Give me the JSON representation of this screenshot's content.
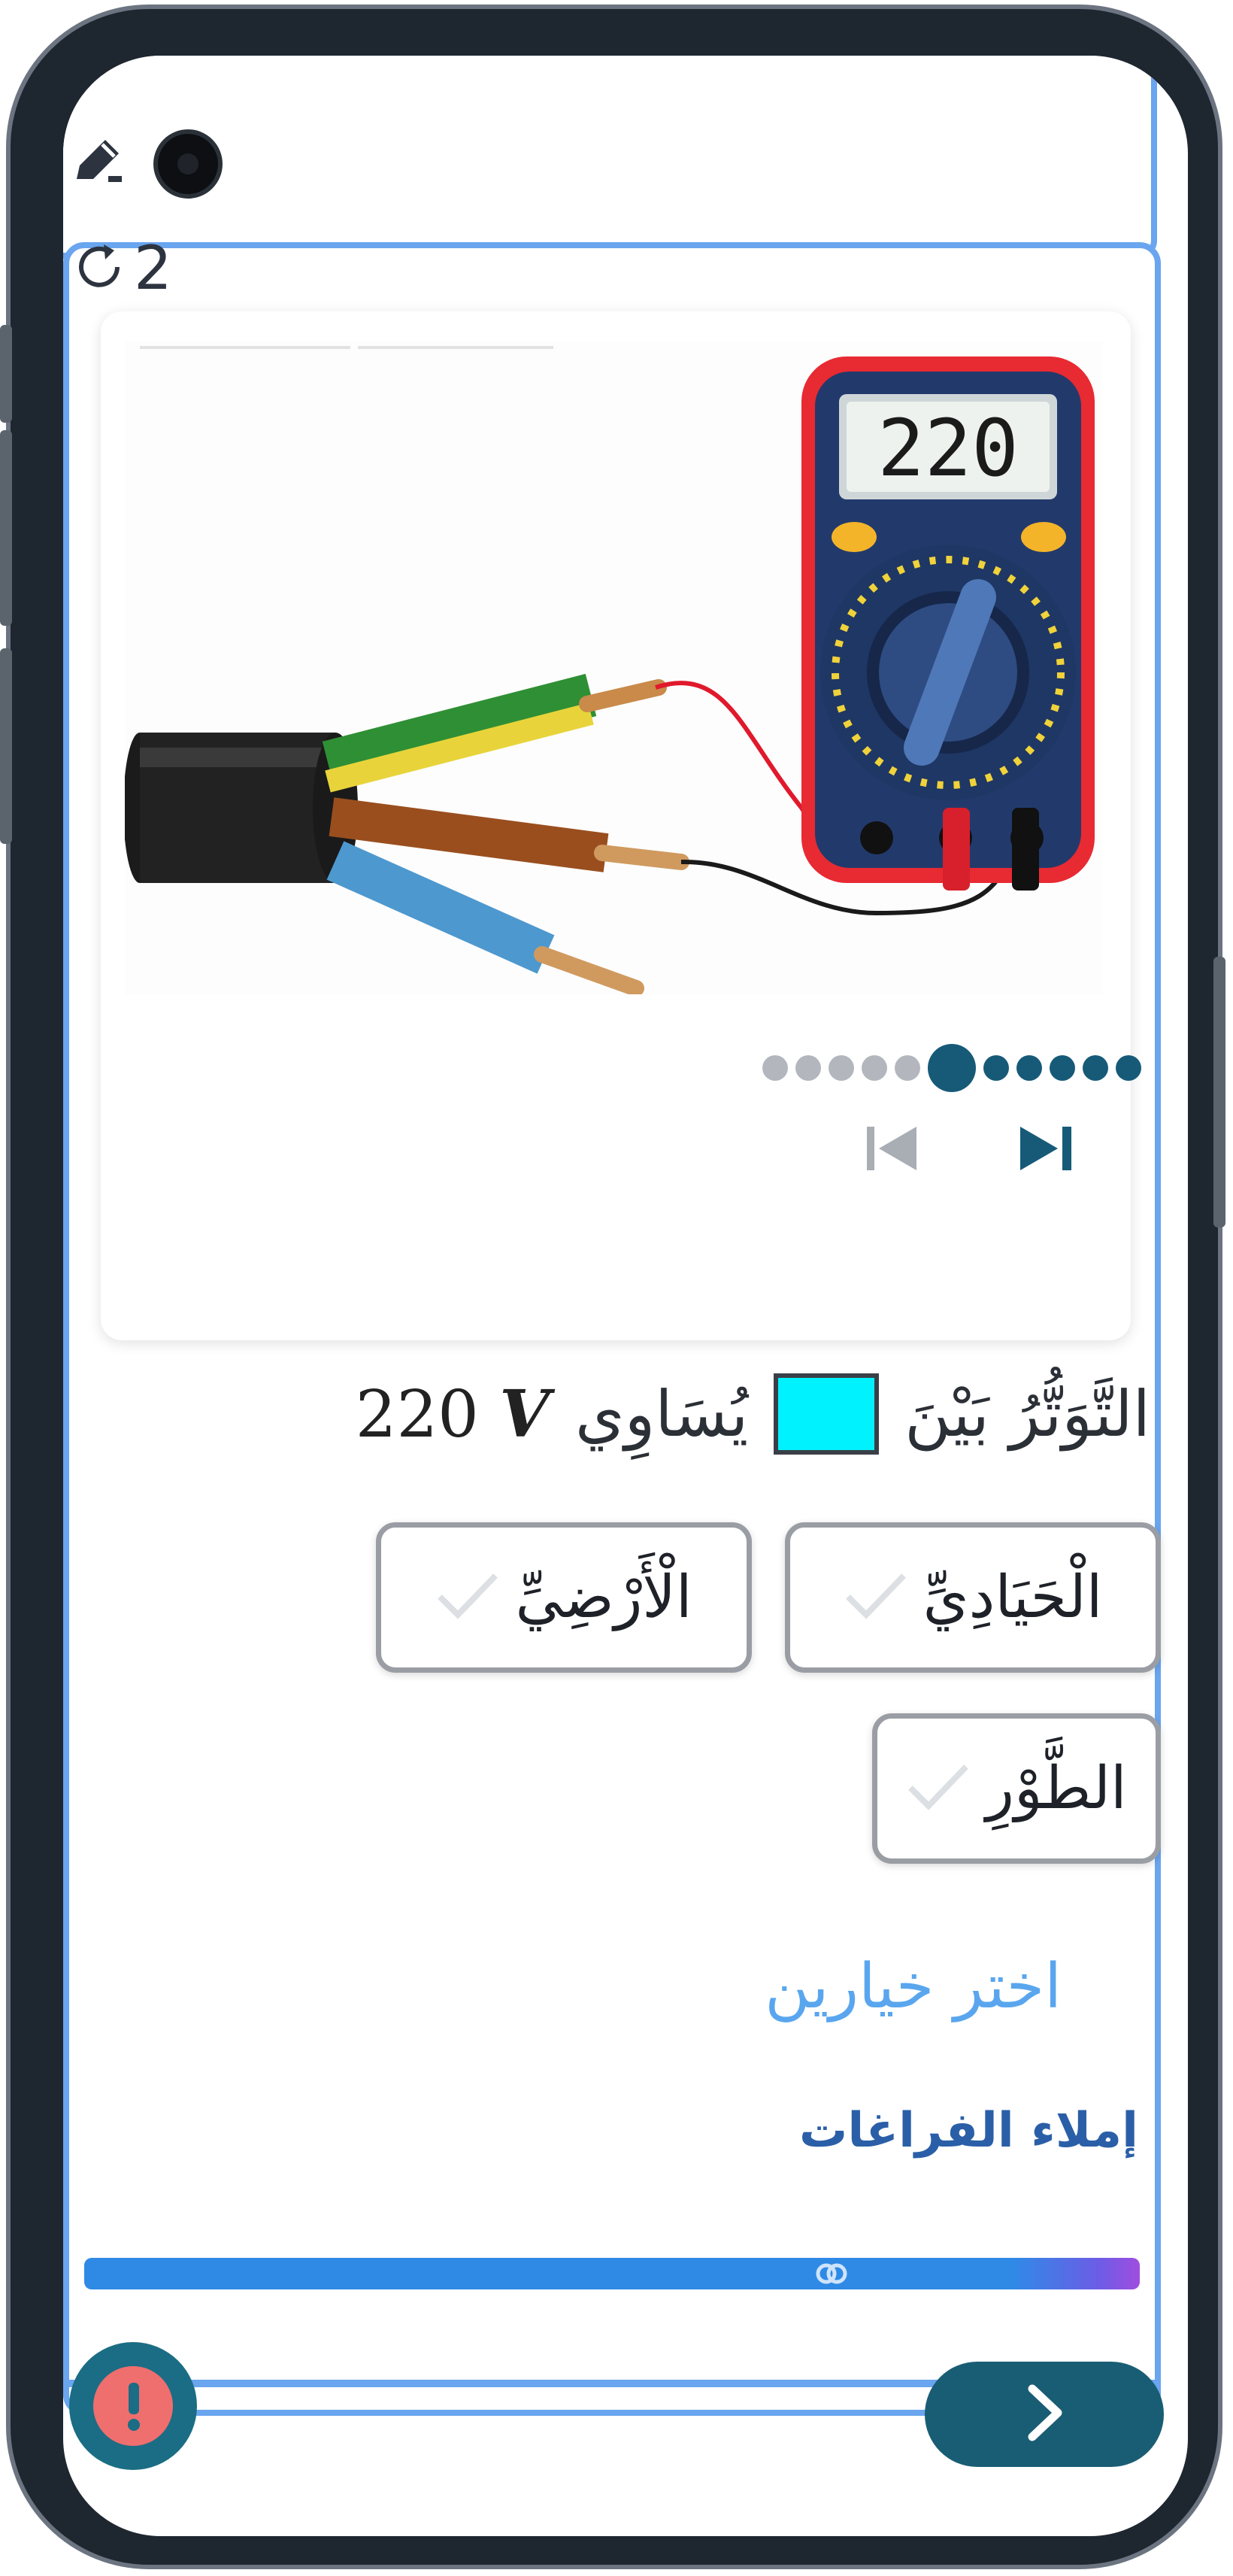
{
  "header": {
    "refresh_count": "2"
  },
  "carousel": {
    "multimeter_reading": "220",
    "total_dots": 11,
    "active_dot": 6
  },
  "question": {
    "prefix": "التَّوَتُّرُ بَيْنَ",
    "equals": "يُسَاوِي",
    "value": "220",
    "unit": "V",
    "blank_color": "#00f2ff"
  },
  "choices": [
    {
      "label": "الْحَيَادِيِّ"
    },
    {
      "label": "الْأَرْضِيِّ"
    },
    {
      "label": "الطَّوْرِ"
    }
  ],
  "instruction": "اختر خيارين",
  "section_title": "إملاء الفراغات",
  "icons": {
    "edit": "pencil-edit-icon",
    "refresh": "refresh-icon",
    "prev": "skip-previous-icon",
    "next": "skip-next-icon",
    "alert": "exclamation-icon",
    "forward": "chevron-right-icon",
    "check": "check-icon"
  },
  "colors": {
    "accent_blue": "#6aa5ef",
    "dark_teal": "#195d74",
    "alert_red": "#ef6e6e",
    "hint_blue": "#5aa6ee",
    "title_blue": "#2a5fa8"
  }
}
